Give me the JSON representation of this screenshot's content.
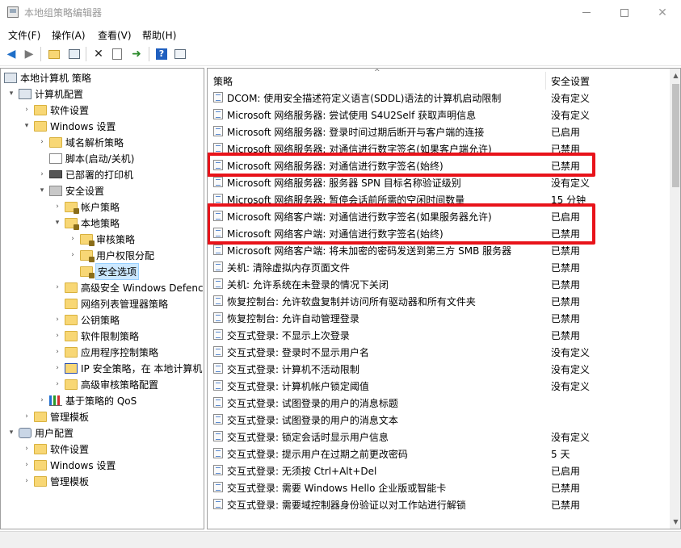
{
  "window": {
    "title": "本地组策略编辑器"
  },
  "menu": [
    "文件(F)",
    "操作(A)",
    "查看(V)",
    "帮助(H)"
  ],
  "toolbar": [
    "back-arrow-icon",
    "forward-arrow-icon",
    "up-folder-icon",
    "show-tree-icon",
    "delete-icon",
    "properties-icon",
    "export-icon",
    "help-icon",
    "view-icon"
  ],
  "tree": [
    {
      "label": "本地计算机 策略",
      "icon": "computer-policy-icon",
      "exp": ""
    },
    {
      "label": "计算机配置",
      "icon": "computer-icon",
      "exp": "▾"
    },
    {
      "label": "软件设置",
      "icon": "folder-icon",
      "exp": "›"
    },
    {
      "label": "Windows 设置",
      "icon": "folder-icon",
      "exp": "▾"
    },
    {
      "label": "域名解析策略",
      "icon": "folder-icon",
      "exp": "›"
    },
    {
      "label": "脚本(启动/关机)",
      "icon": "script-icon",
      "exp": ""
    },
    {
      "label": "已部署的打印机",
      "icon": "printer-icon",
      "exp": "›"
    },
    {
      "label": "安全设置",
      "icon": "security-icon",
      "exp": "▾"
    },
    {
      "label": "帐户策略",
      "icon": "folder-icon",
      "exp": "›"
    },
    {
      "label": "本地策略",
      "icon": "folder-icon",
      "exp": "▾"
    },
    {
      "label": "审核策略",
      "icon": "folder-icon",
      "exp": "›"
    },
    {
      "label": "用户权限分配",
      "icon": "folder-icon",
      "exp": "›"
    },
    {
      "label": "安全选项",
      "icon": "folder-icon",
      "exp": ""
    },
    {
      "label": "高级安全 Windows Defenc",
      "icon": "folder-icon",
      "exp": "›"
    },
    {
      "label": "网络列表管理器策略",
      "icon": "folder-icon",
      "exp": ""
    },
    {
      "label": "公钥策略",
      "icon": "folder-icon",
      "exp": "›"
    },
    {
      "label": "软件限制策略",
      "icon": "folder-icon",
      "exp": "›"
    },
    {
      "label": "应用程序控制策略",
      "icon": "folder-icon",
      "exp": "›"
    },
    {
      "label": "IP 安全策略，在 本地计算机",
      "icon": "ip-security-icon",
      "exp": "›"
    },
    {
      "label": "高级审核策略配置",
      "icon": "folder-icon",
      "exp": "›"
    },
    {
      "label": "基于策略的 QoS",
      "icon": "chart-icon",
      "exp": "›"
    },
    {
      "label": "管理模板",
      "icon": "folder-icon",
      "exp": "›"
    },
    {
      "label": "用户配置",
      "icon": "user-icon",
      "exp": "▾"
    },
    {
      "label": "软件设置",
      "icon": "folder-icon",
      "exp": "›"
    },
    {
      "label": "Windows 设置",
      "icon": "folder-icon",
      "exp": "›"
    },
    {
      "label": "管理模板",
      "icon": "folder-icon",
      "exp": "›"
    }
  ],
  "list": {
    "sort_indicator": "^",
    "col_policy": "策略",
    "col_setting": "安全设置",
    "rows": [
      {
        "policy": "DCOM: 使用安全描述符定义语言(SDDL)语法的计算机启动限制",
        "setting": "没有定义"
      },
      {
        "policy": "Microsoft 网络服务器: 尝试使用 S4U2Self 获取声明信息",
        "setting": "没有定义"
      },
      {
        "policy": "Microsoft 网络服务器: 登录时间过期后断开与客户端的连接",
        "setting": "已启用"
      },
      {
        "policy": "Microsoft 网络服务器: 对通信进行数字签名(如果客户端允许)",
        "setting": "已禁用"
      },
      {
        "policy": "Microsoft 网络服务器: 对通信进行数字签名(始终)",
        "setting": "已禁用"
      },
      {
        "policy": "Microsoft 网络服务器: 服务器 SPN 目标名称验证级别",
        "setting": "没有定义"
      },
      {
        "policy": "Microsoft 网络服务器: 暂停会话前所需的空闲时间数量",
        "setting": "15 分钟"
      },
      {
        "policy": "Microsoft 网络客户端: 对通信进行数字签名(如果服务器允许)",
        "setting": "已启用"
      },
      {
        "policy": "Microsoft 网络客户端: 对通信进行数字签名(始终)",
        "setting": "已禁用"
      },
      {
        "policy": "Microsoft 网络客户端: 将未加密的密码发送到第三方 SMB 服务器",
        "setting": "已禁用"
      },
      {
        "policy": "关机: 清除虚拟内存页面文件",
        "setting": "已禁用"
      },
      {
        "policy": "关机: 允许系统在未登录的情况下关闭",
        "setting": "已禁用"
      },
      {
        "policy": "恢复控制台: 允许软盘复制并访问所有驱动器和所有文件夹",
        "setting": "已禁用"
      },
      {
        "policy": "恢复控制台: 允许自动管理登录",
        "setting": "已禁用"
      },
      {
        "policy": "交互式登录: 不显示上次登录",
        "setting": "已禁用"
      },
      {
        "policy": "交互式登录: 登录时不显示用户名",
        "setting": "没有定义"
      },
      {
        "policy": "交互式登录: 计算机不活动限制",
        "setting": "没有定义"
      },
      {
        "policy": "交互式登录: 计算机帐户锁定阈值",
        "setting": "没有定义"
      },
      {
        "policy": "交互式登录: 试图登录的用户的消息标题",
        "setting": ""
      },
      {
        "policy": "交互式登录: 试图登录的用户的消息文本",
        "setting": ""
      },
      {
        "policy": "交互式登录: 锁定会话时显示用户信息",
        "setting": "没有定义"
      },
      {
        "policy": "交互式登录: 提示用户在过期之前更改密码",
        "setting": "5 天"
      },
      {
        "policy": "交互式登录: 无须按 Ctrl+Alt+Del",
        "setting": "已启用"
      },
      {
        "policy": "交互式登录: 需要 Windows Hello 企业版或智能卡",
        "setting": "已禁用"
      },
      {
        "policy": "交互式登录: 需要域控制器身份验证以对工作站进行解锁",
        "setting": "已禁用"
      }
    ]
  },
  "highlight_color": "#e8131a",
  "selection_color": "#cce8ff"
}
